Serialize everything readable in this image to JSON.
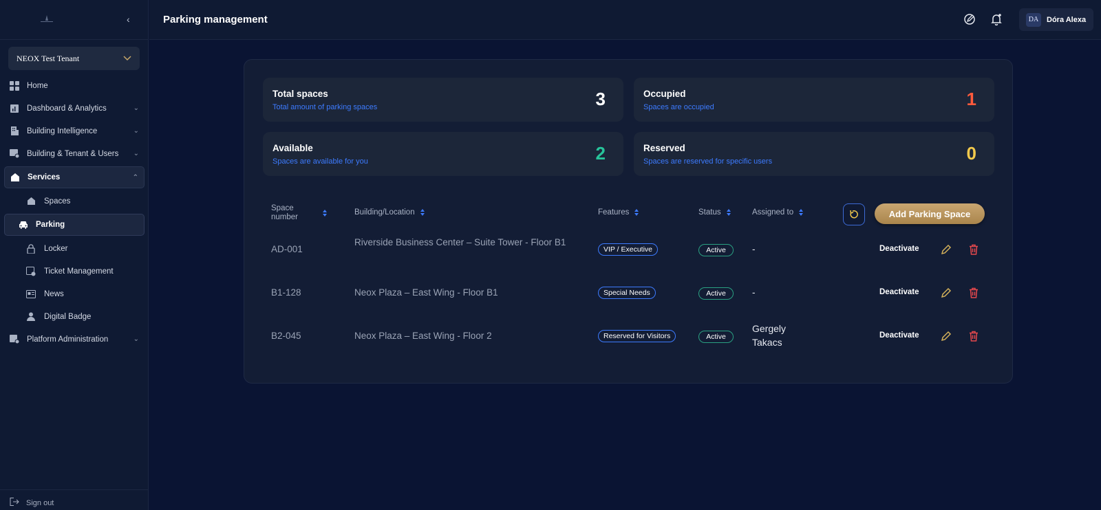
{
  "sidebar": {
    "tenant": "NEOX Test Tenant",
    "items": [
      {
        "label": "Home"
      },
      {
        "label": "Dashboard & Analytics"
      },
      {
        "label": "Building Intelligence"
      },
      {
        "label": "Building & Tenant & Users"
      },
      {
        "label": "Services"
      },
      {
        "label": "Spaces"
      },
      {
        "label": "Parking"
      },
      {
        "label": "Locker"
      },
      {
        "label": "Ticket Management"
      },
      {
        "label": "News"
      },
      {
        "label": "Digital Badge"
      },
      {
        "label": "Platform Administration"
      }
    ],
    "sign_out": "Sign out"
  },
  "header": {
    "title": "Parking management",
    "user_initials": "DA",
    "user_name": "Dóra Alexa"
  },
  "stats": [
    {
      "title": "Total spaces",
      "subtitle": "Total amount of parking spaces",
      "value": "3",
      "color": "#ffffff"
    },
    {
      "title": "Occupied",
      "subtitle": "Spaces are occupied",
      "value": "1",
      "color": "#ff5a3c"
    },
    {
      "title": "Available",
      "subtitle": "Spaces are available for you",
      "value": "2",
      "color": "#27c39a"
    },
    {
      "title": "Reserved",
      "subtitle": "Spaces are reserved for specific users",
      "value": "0",
      "color": "#f2c94c"
    }
  ],
  "table": {
    "headers": {
      "space_number": "Space number",
      "building": "Building/Location",
      "features": "Features",
      "status": "Status",
      "assigned": "Assigned to"
    },
    "add_button": "Add Parking Space",
    "rows": [
      {
        "space": "AD-001",
        "building": "Riverside Business Center – Suite Tower - Floor B1",
        "feature": "VIP / Executive",
        "status": "Active",
        "assigned": "-",
        "action": "Deactivate"
      },
      {
        "space": "B1-128",
        "building": "Neox Plaza – East Wing - Floor B1",
        "feature": "Special Needs",
        "status": "Active",
        "assigned": "-",
        "action": "Deactivate"
      },
      {
        "space": "B2-045",
        "building": "Neox Plaza – East Wing - Floor 2",
        "feature": "Reserved for Visitors",
        "status": "Active",
        "assigned": "Gergely Takacs",
        "action": "Deactivate"
      }
    ]
  }
}
